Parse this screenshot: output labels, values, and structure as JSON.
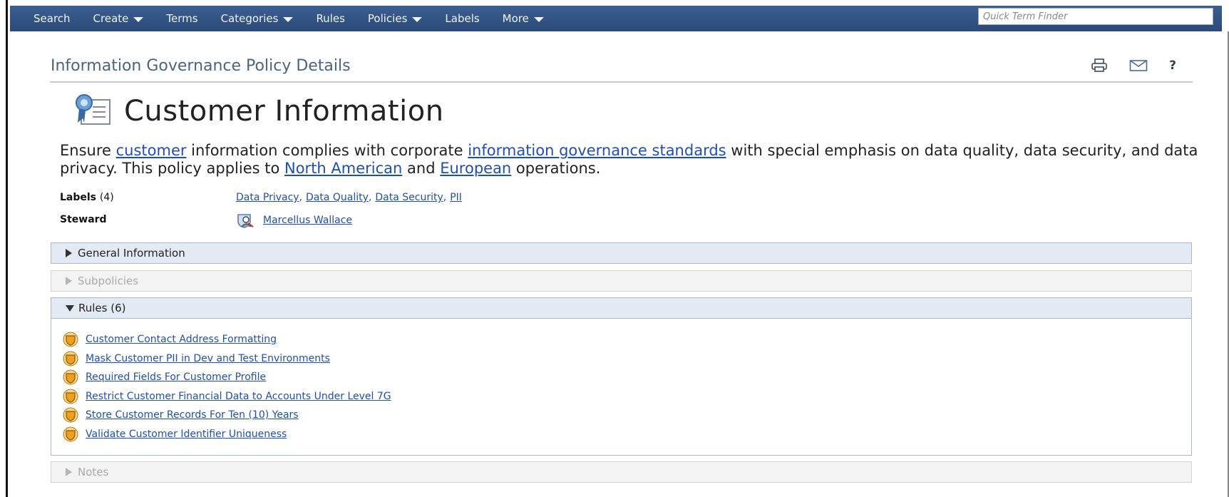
{
  "nav": {
    "items": [
      {
        "label": "Search",
        "dropdown": false
      },
      {
        "label": "Create",
        "dropdown": true
      },
      {
        "label": "Terms",
        "dropdown": false
      },
      {
        "label": "Categories",
        "dropdown": true
      },
      {
        "label": "Rules",
        "dropdown": false
      },
      {
        "label": "Policies",
        "dropdown": true
      },
      {
        "label": "Labels",
        "dropdown": false
      },
      {
        "label": "More",
        "dropdown": true
      }
    ],
    "finder_placeholder": "Quick Term Finder"
  },
  "header": {
    "page_heading": "Information Governance Policy Details",
    "tools": [
      "printer-icon",
      "mail-icon",
      "help-icon"
    ],
    "help_label": "?"
  },
  "policy": {
    "title": "Customer Information",
    "icon": "policy-certificate-icon",
    "description": {
      "t1": "Ensure ",
      "link1": "customer",
      "t2": " information complies with corporate ",
      "link2": "information governance standards",
      "t3": " with special emphasis on data quality, data security, and data privacy. This policy applies to ",
      "link3": "North American",
      "t4": " and ",
      "link4": "European",
      "t5": " operations."
    },
    "labels_label": "Labels",
    "labels_count": "(4)",
    "labels": [
      "Data Privacy",
      "Data Quality",
      "Data Security",
      "PII"
    ],
    "steward_label": "Steward",
    "steward_name": "Marcellus Wallace",
    "steward_icon": "steward-user-icon"
  },
  "sections": {
    "general": "General Information",
    "subpolicies": "Subpolicies",
    "rules": "Rules (6)",
    "notes": "Notes"
  },
  "rules": [
    "Customer Contact Address Formatting",
    "Mask Customer PII in Dev and Test Environments",
    "Required Fields For Customer Profile",
    "Restrict Customer Financial Data to Accounts Under Level 7G",
    "Store Customer Records For Ten (10) Years",
    "Validate Customer Identifier Uniqueness"
  ],
  "colors": {
    "nav_bg": "#2f5283",
    "link": "#1f4fb3",
    "heading": "#4b6480",
    "section_header_bg": "#e3eaf3",
    "rule_icon": "#f0a020"
  }
}
